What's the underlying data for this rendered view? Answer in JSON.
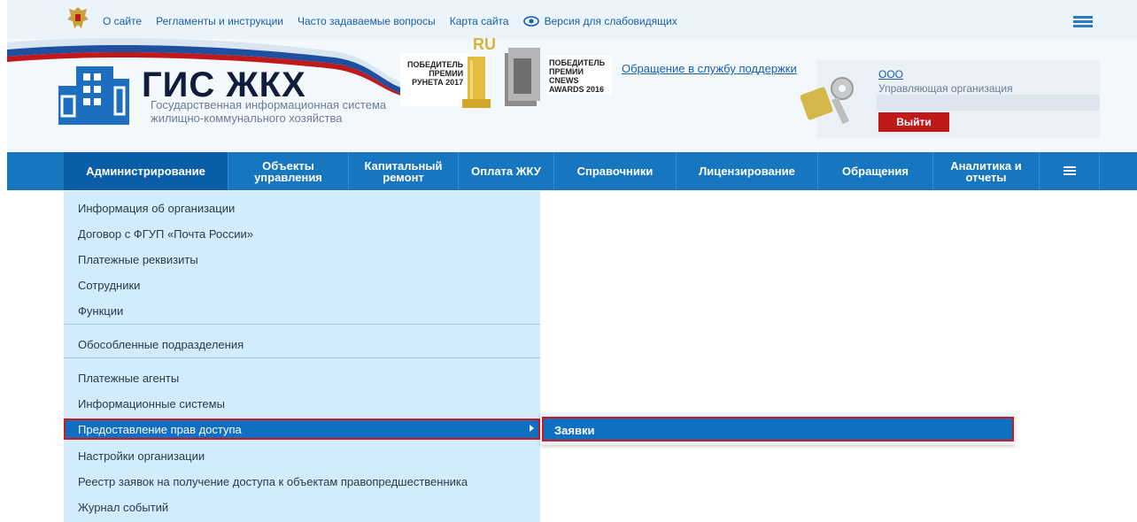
{
  "topbar": {
    "links": [
      "О сайте",
      "Регламенты и инструкции",
      "Часто задаваемые вопросы",
      "Карта сайта"
    ],
    "accessibility": "Версия для слабовидящих"
  },
  "header": {
    "title": "ГИС ЖКХ",
    "subtitle_line1": "Государственная информационная система",
    "subtitle_line2": "жилищно-коммунального хозяйства",
    "award1_line1": "ПОБЕДИТЕЛЬ",
    "award1_line2": "ПРЕМИИ",
    "award1_line3": "РУНЕТА 2017",
    "award1_badge": "RU",
    "award2_line1": "ПОБЕДИТЕЛЬ",
    "award2_line2": "ПРЕМИИ",
    "award2_line3": "CNEWS",
    "award2_line4": "AWARDS 2016",
    "support_link": "Обращение в службу поддержки"
  },
  "user": {
    "org_name": "ООО",
    "org_role": "Управляющая организация",
    "logout": "Выйти"
  },
  "nav": {
    "items": [
      {
        "label": "Администрирование"
      },
      {
        "label": "Объекты управления"
      },
      {
        "label": "Капитальный ремонт"
      },
      {
        "label": "Оплата ЖКУ"
      },
      {
        "label": "Справочники"
      },
      {
        "label": "Лицензирование"
      },
      {
        "label": "Обращения"
      },
      {
        "label": "Аналитика и отчеты"
      }
    ]
  },
  "dropdown": {
    "items": [
      "Информация об организации",
      "Договор с ФГУП «Почта России»",
      "Платежные реквизиты",
      "Сотрудники",
      "Функции",
      "Обособленные подразделения",
      "Платежные агенты",
      "Информационные системы",
      "Предоставление прав доступа",
      "Настройки организации",
      "Реестр заявок на получение доступа к объектам правопредшественника",
      "Журнал событий"
    ]
  },
  "submenu": {
    "items": [
      "Заявки"
    ]
  },
  "colors": {
    "nav_bg": "#1776c0",
    "nav_active": "#0a5ea8",
    "dropdown_bg": "#d3ecfb",
    "highlight": "#0f6fc0",
    "focus_border": "#d3171d",
    "logout_bg": "#c0191a"
  }
}
